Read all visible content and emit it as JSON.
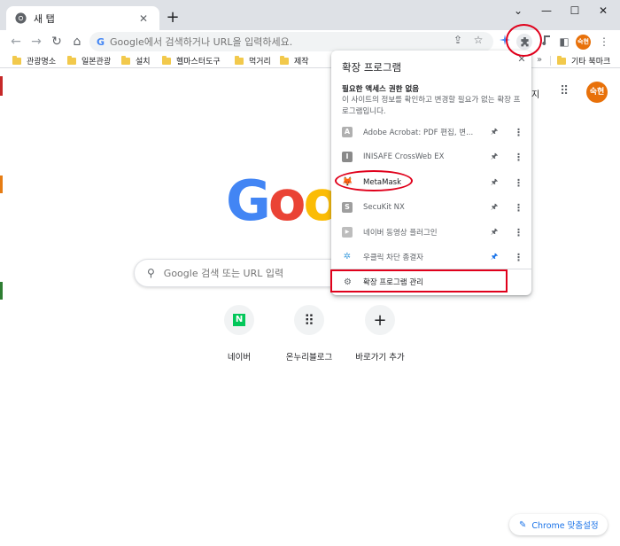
{
  "tab": {
    "title": "새 탭",
    "close_glyph": "✕",
    "new_tab_glyph": "+"
  },
  "window_controls": {
    "menu_glyph": "⌄",
    "minimize_glyph": "—",
    "maximize_glyph": "☐",
    "close_glyph": "✕"
  },
  "toolbar": {
    "back_glyph": "←",
    "forward_glyph": "→",
    "reload_glyph": "↻",
    "home_glyph": "⌂",
    "omnibox_g": "G",
    "omnibox_placeholder": "Google에서 검색하거나 URL을 입력하세요.",
    "share_glyph": "⇪",
    "star_glyph": "☆",
    "sidepanel_glyph": "◧",
    "menu_glyph": "⋮",
    "profile_initials": "숙현"
  },
  "bookmarks": {
    "items": [
      {
        "label": "관광명소"
      },
      {
        "label": "일본관광"
      },
      {
        "label": "설치"
      },
      {
        "label": "헬마스터도구"
      },
      {
        "label": "먹거리"
      },
      {
        "label": "제작"
      }
    ],
    "overflow_glyph": "»",
    "other_label": "기타 북마크"
  },
  "page": {
    "gmail_partial": "지",
    "apps_glyph": "⠿",
    "avatar_initials": "숙현",
    "google_letters": [
      {
        "ch": "G",
        "color": "#4285f4"
      },
      {
        "ch": "o",
        "color": "#ea4335"
      },
      {
        "ch": "o",
        "color": "#fbbc05"
      },
      {
        "ch": "g",
        "color": "#4285f4"
      },
      {
        "ch": "l",
        "color": "#34a853"
      },
      {
        "ch": "e",
        "color": "#ea4335"
      }
    ],
    "search_placeholder": "Google 검색 또는 URL 입력",
    "search_glyph": "⚲",
    "shortcuts": [
      {
        "label": "네이버",
        "glyph": "N"
      },
      {
        "label": "온누리블로그",
        "glyph": "⠿"
      },
      {
        "label": "바로가기 추가",
        "glyph": "+"
      }
    ],
    "customize_label": "Chrome 맞춤설정",
    "customize_glyph": "✎"
  },
  "extensions_popup": {
    "title": "확장 프로그램",
    "close_glyph": "✕",
    "section_title": "필요한 액세스 권한 없음",
    "section_desc": "이 사이트의 정보를 확인하고 변경할 필요가 없는 확장 프로그램입니다.",
    "items": [
      {
        "name": "Adobe Acrobat: PDF 편집, 변...",
        "icon": "A",
        "icon_color": "#b0b0b0",
        "pinned": false,
        "active": false
      },
      {
        "name": "INISAFE CrossWeb EX",
        "icon": "I",
        "icon_color": "#8a8a8a",
        "pinned": false,
        "active": false
      },
      {
        "name": "MetaMask",
        "icon": "🦊",
        "icon_color": "#f6851b",
        "pinned": false,
        "active": true
      },
      {
        "name": "SecuKit NX",
        "icon": "S",
        "icon_color": "#9e9e9e",
        "pinned": false,
        "active": false
      },
      {
        "name": "네이버 동영상 플러그인",
        "icon": "▶",
        "icon_color": "#bdbdbd",
        "pinned": false,
        "active": false
      },
      {
        "name": "우클릭 차단 종결자",
        "icon": "✲",
        "icon_color": "#4aa3df",
        "pinned": true,
        "active": false
      }
    ],
    "pin_glyph": "🖈",
    "more_glyph": "⋮",
    "manage_label": "확장 프로그램 관리",
    "manage_glyph": "⚙"
  },
  "colors": {
    "accent": "#1a73e8",
    "annotation_red": "#e0001b",
    "profile_orange": "#e8710a"
  }
}
